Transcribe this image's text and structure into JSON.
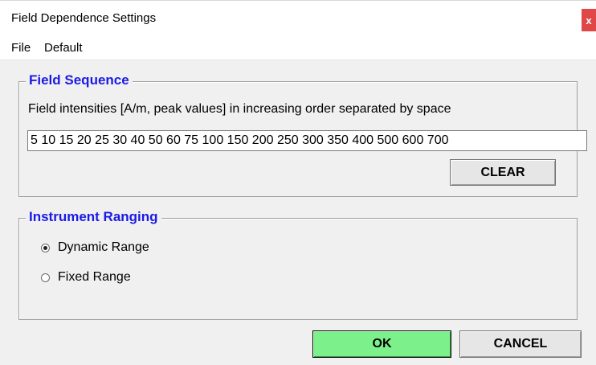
{
  "window": {
    "title": "Field Dependence Settings",
    "close_glyph": "x"
  },
  "menu": {
    "items": [
      {
        "label": "File"
      },
      {
        "label": "Default"
      }
    ]
  },
  "field_sequence": {
    "legend": "Field Sequence",
    "description": "Field intensities [A/m, peak values] in increasing order separated by space",
    "value": "5 10 15 20 25 30 40 50 60 75 100 150 200 250 300 350 400 500 600 700",
    "clear_label": "CLEAR"
  },
  "instrument_ranging": {
    "legend": "Instrument Ranging",
    "options": [
      {
        "label": "Dynamic Range",
        "selected": true
      },
      {
        "label": "Fixed Range",
        "selected": false
      }
    ]
  },
  "footer": {
    "ok_label": "OK",
    "cancel_label": "CANCEL"
  },
  "colors": {
    "legend": "#1a1ae6",
    "ok_button": "#7cf08a",
    "close_button": "#e04848",
    "client_bg": "#f0f0f0"
  }
}
